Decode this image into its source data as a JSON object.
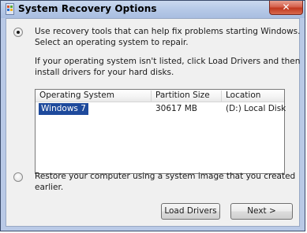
{
  "window": {
    "title": "System Recovery Options",
    "icon": "windows-flag-icon",
    "close_label": "✕"
  },
  "option_repair": {
    "selected": true,
    "line1": "Use recovery tools that can help fix problems starting Windows.",
    "line2": "Select an operating system to repair.",
    "hint_line1": "If your operating system isn't listed, click Load Drivers and then",
    "hint_line2": "install drivers for your hard disks."
  },
  "os_list": {
    "columns": [
      "Operating System",
      "Partition Size",
      "Location"
    ],
    "rows": [
      {
        "os": "Windows 7",
        "size": "30617 MB",
        "location": "(D:) Local Disk",
        "selected": true
      }
    ]
  },
  "option_restore": {
    "selected": false,
    "line1": "Restore your computer using a system image that you created",
    "line2": "earlier."
  },
  "buttons": {
    "load_drivers": "Load Drivers",
    "next": "Next >"
  },
  "colors": {
    "selection": "#1e4a9c",
    "frame": "#b9c9e6",
    "close": "#c0381f"
  }
}
